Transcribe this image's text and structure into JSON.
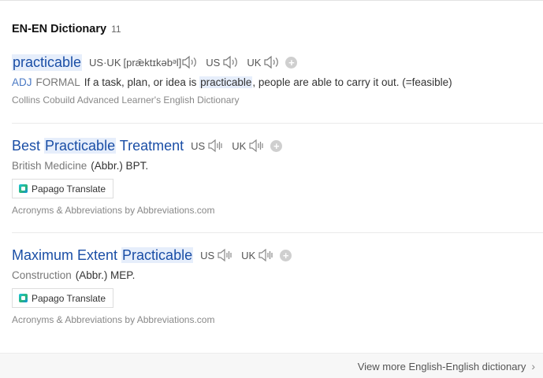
{
  "header": {
    "title": "EN-EN Dictionary",
    "count": "11"
  },
  "entries": [
    {
      "word": "practicable",
      "pron_us_uk_label": "US·UK",
      "phonetic": "[prǣktɪkəbᵊl]",
      "us_label": "US",
      "uk_label": "UK",
      "pos": "ADJ",
      "grammar": "FORMAL",
      "def_before": "If a task, plan, or idea is ",
      "def_highlight": "practicable",
      "def_after": ", people are able to carry it out. (=feasible)",
      "source": "Collins Cobuild Advanced Learner's English Dictionary"
    },
    {
      "word_before": "Best ",
      "word_highlight": "Practicable",
      "word_after": " Treatment",
      "us_label": "US",
      "uk_label": "UK",
      "category": "British Medicine",
      "abbr": "(Abbr.) BPT.",
      "papago_label": "Papago Translate",
      "source": "Acronyms & Abbreviations by Abbreviations.com"
    },
    {
      "word_before": "Maximum Extent ",
      "word_highlight": "Practicable",
      "word_after": "",
      "us_label": "US",
      "uk_label": "UK",
      "category": "Construction",
      "abbr": "(Abbr.) MEP.",
      "papago_label": "Papago Translate",
      "source": "Acronyms & Abbreviations by Abbreviations.com"
    }
  ],
  "footer": {
    "more_label": "View more English-English dictionary"
  },
  "colors": {
    "word": "#1a4ea6",
    "highlight": "#e6eefb",
    "pos": "#4a79c4"
  }
}
